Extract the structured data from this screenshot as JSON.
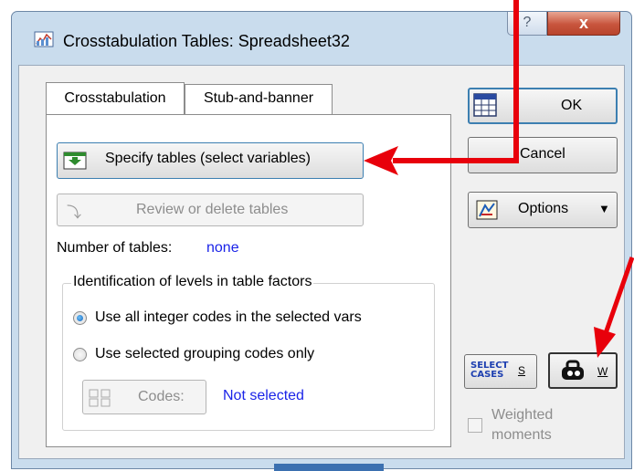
{
  "window": {
    "title": "Crosstabulation Tables: Spreadsheet32",
    "help_glyph": "?",
    "close_glyph": "x"
  },
  "tabs": [
    {
      "label": "Crosstabulation",
      "selected": true
    },
    {
      "label": "Stub-and-banner",
      "selected": false
    }
  ],
  "buttons": {
    "specify": "Specify tables (select variables)",
    "review": "Review or delete tables",
    "ok": "OK",
    "cancel": "Cancel",
    "options": "Options",
    "select_cases_top": "SELECT",
    "select_cases_bottom": "CASES",
    "select_cases_key": "S",
    "weight_key": "W",
    "codes": "Codes:"
  },
  "info": {
    "num_tables_label": "Number of tables:",
    "num_tables_value": "none"
  },
  "group": {
    "title": "Identification of levels in table factors",
    "option1": "Use all integer codes in the selected vars",
    "option2": "Use selected grouping codes only",
    "codes_status": "Not selected"
  },
  "weighted": {
    "line1": "Weighted",
    "line2": "moments",
    "checked": false
  },
  "colors": {
    "annotation_arrow": "#e8000b",
    "link_blue": "#1a23e8",
    "close_red": "#c8553d"
  }
}
